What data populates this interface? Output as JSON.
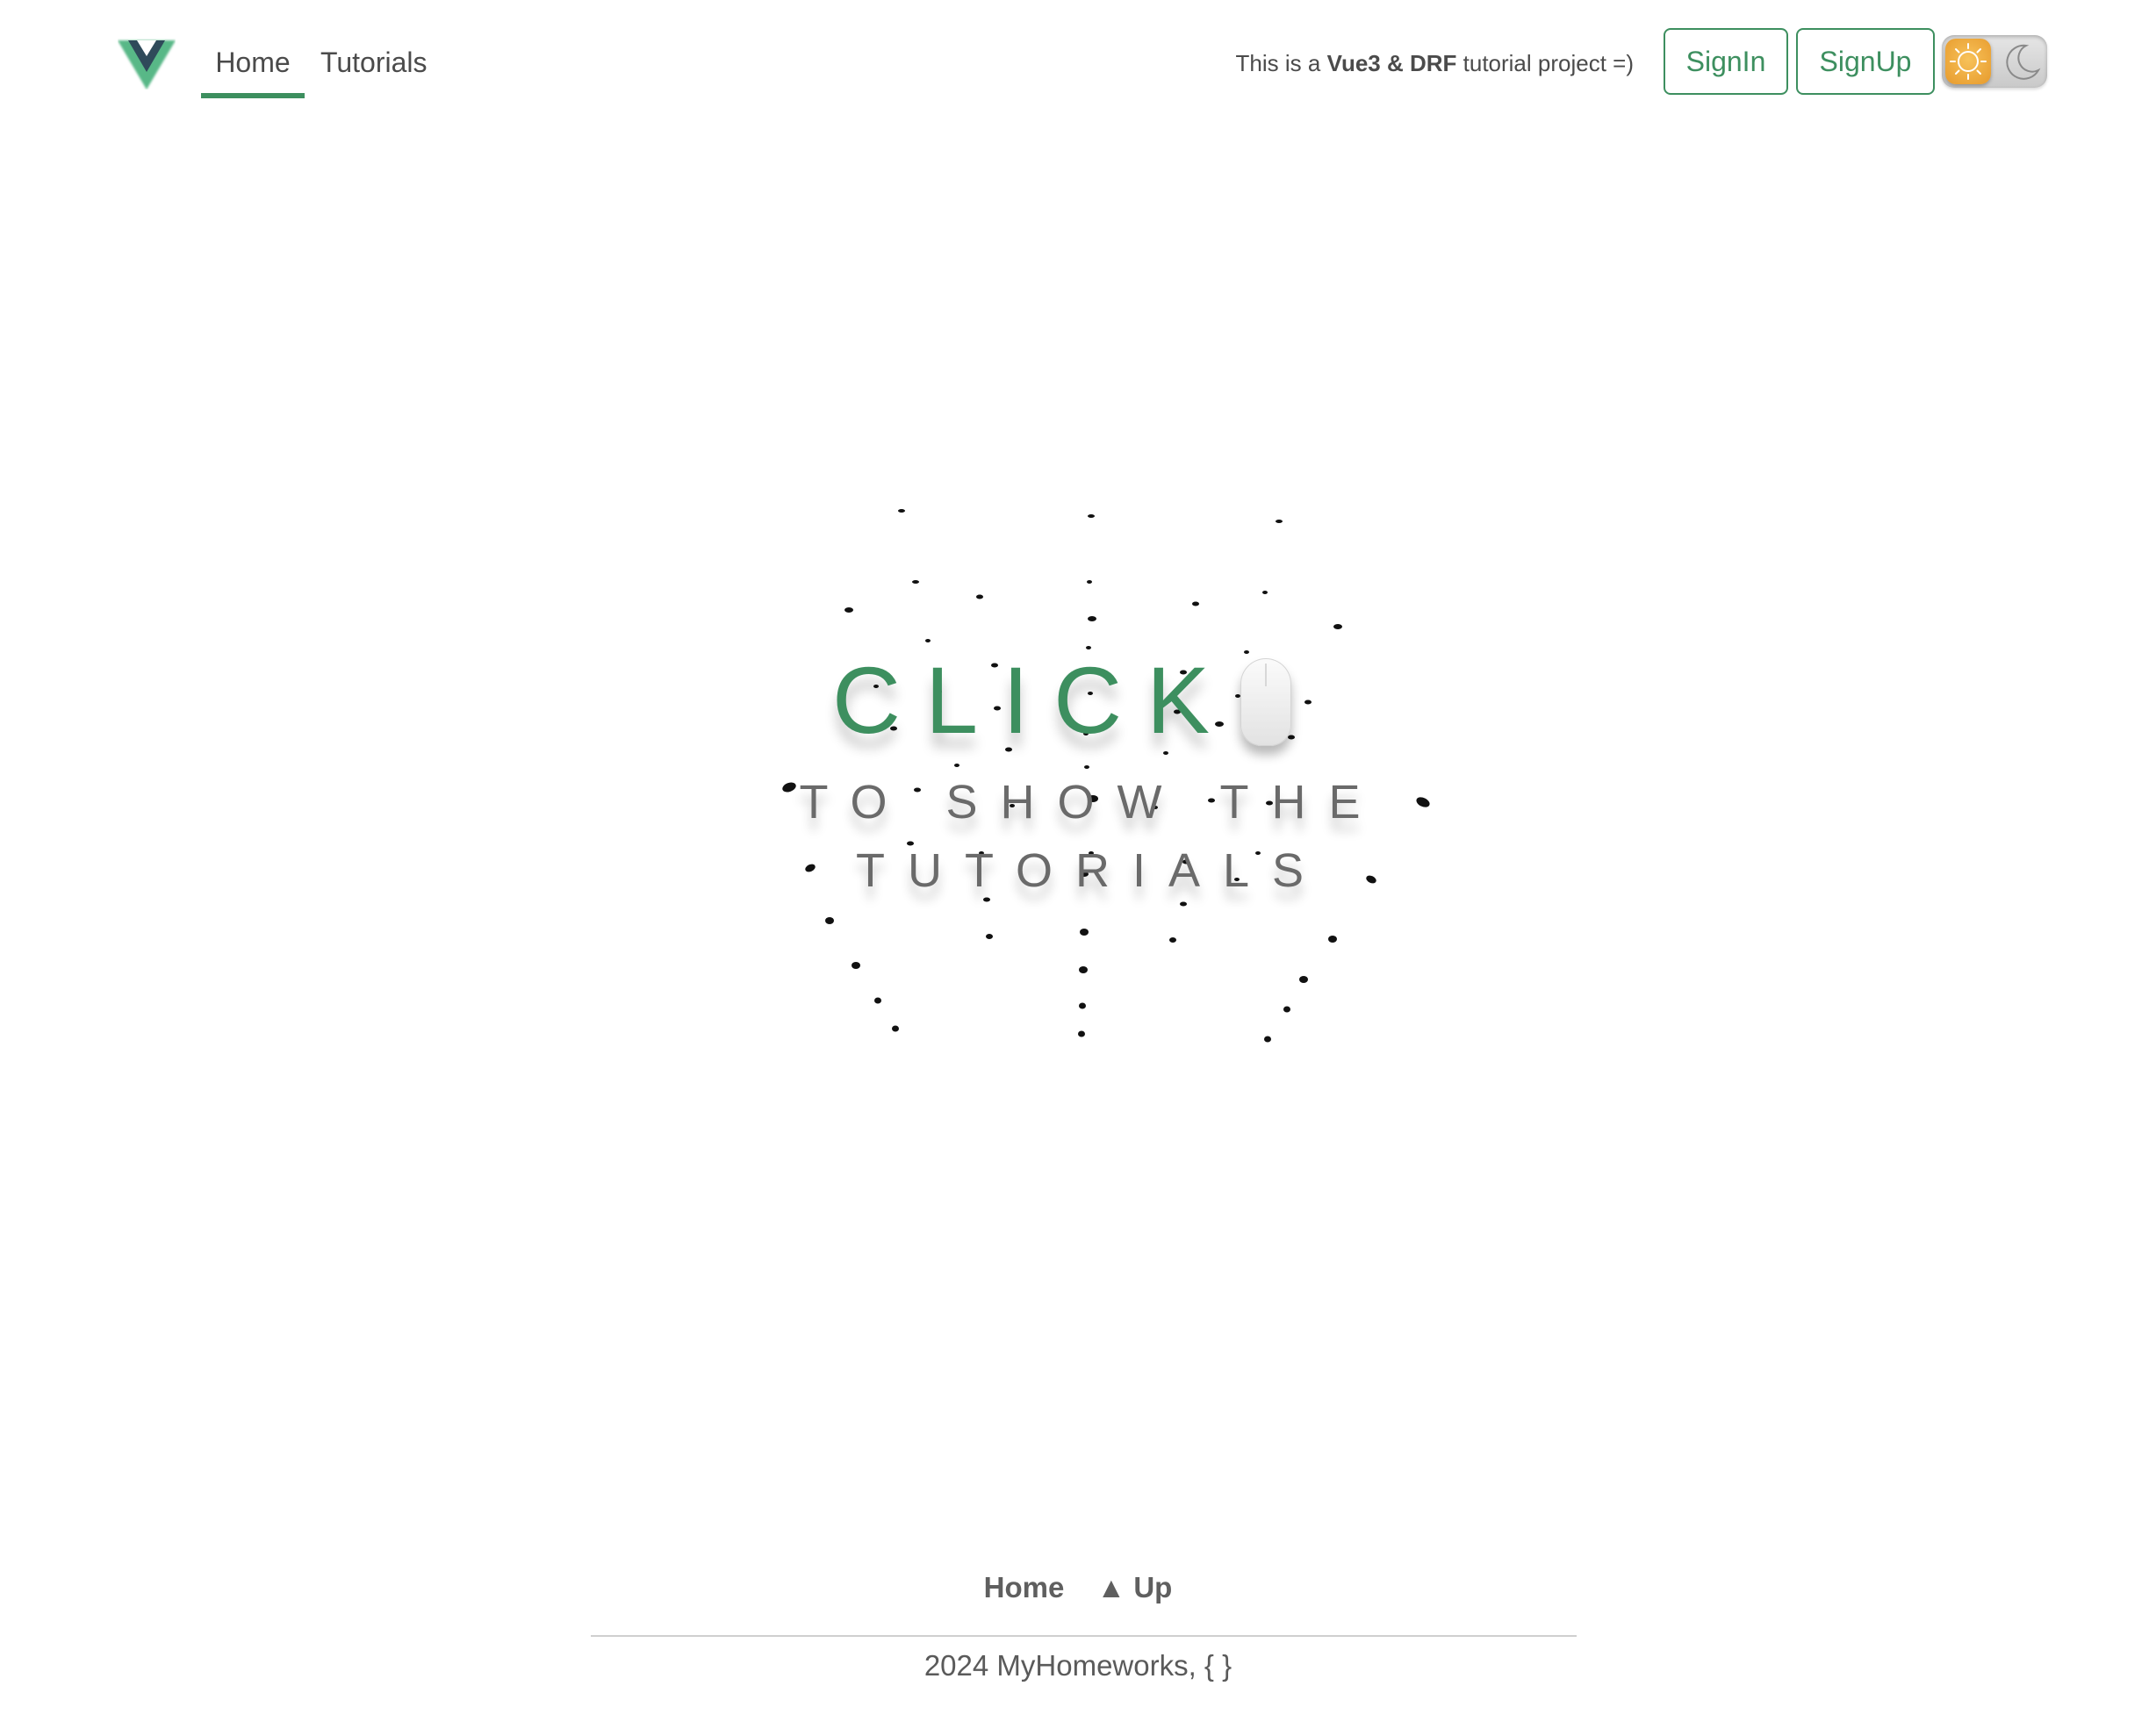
{
  "header": {
    "logo": "vue-logo",
    "nav": [
      {
        "label": "Home",
        "active": true
      },
      {
        "label": "Tutorials",
        "active": false
      }
    ],
    "tagline": {
      "prefix": "This is a ",
      "highlight": "Vue3 & DRF",
      "suffix": " tutorial project =)"
    },
    "signin_label": "SignIn",
    "signup_label": "SignUp",
    "theme_toggle": {
      "current": "light",
      "icons": [
        "sun-icon",
        "moon-icon"
      ]
    }
  },
  "hero": {
    "click_text": "CLICK",
    "icon": "mouse-icon",
    "line1": "TO SHOW THE",
    "line2": "TUTORIALS"
  },
  "footer": {
    "home_label": "Home",
    "up_label": "▲ Up",
    "copyright": "2024 MyHomeworks, { }"
  },
  "colors": {
    "accent": "#3d8f5f",
    "text": "#4b4b4b",
    "subtext": "#6a6a6a"
  }
}
